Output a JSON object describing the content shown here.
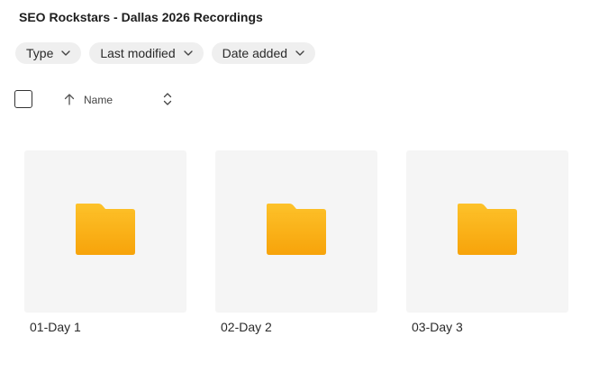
{
  "header": {
    "title": "SEO Rockstars - Dallas 2026 Recordings"
  },
  "filters": [
    {
      "label": "Type"
    },
    {
      "label": "Last modified"
    },
    {
      "label": "Date added"
    }
  ],
  "sort": {
    "label": "Name",
    "direction": "ascending"
  },
  "folders": [
    {
      "name": "01-Day 1"
    },
    {
      "name": "02-Day 2"
    },
    {
      "name": "03-Day 3"
    }
  ],
  "colors": {
    "folder_top": "#fdc22a",
    "folder_bottom": "#f7a30a",
    "folder_tab": "#f9ad15",
    "thumb_bg": "#f5f5f5",
    "chip_bg": "#efefef"
  }
}
